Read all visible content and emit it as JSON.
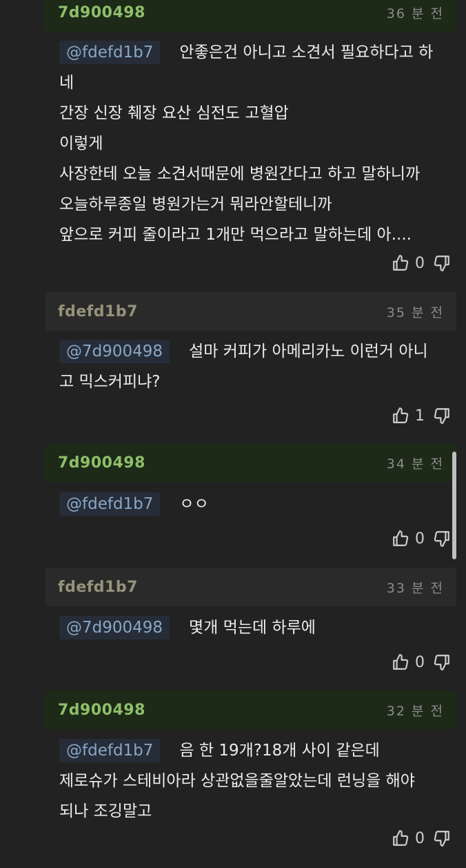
{
  "comments": [
    {
      "author": "7d900498",
      "time": "36 분 전",
      "mention": "@fdefd1b7",
      "lines": [
        "안좋은건 아니고 소견서 필요하다고 하",
        "네",
        "간장 신장 췌장 요산 심전도 고혈압",
        "이렇게",
        "사장한테 오늘 소견서때문에 병원간다고 하고 말하니까",
        "오늘하루종일 병원가는거 뭐라안할테니까",
        "앞으로 커피 줄이라고 1개만 먹으라고 말하는데 아...."
      ],
      "likes": "0"
    },
    {
      "author": "fdefd1b7",
      "time": "35 분 전",
      "mention": "@7d900498",
      "lines": [
        "설마 커피가 아메리카노 이런거 아니",
        "고 믹스커피냐?"
      ],
      "likes": "1"
    },
    {
      "author": "7d900498",
      "time": "34 분 전",
      "mention": "@fdefd1b7",
      "lines": [
        "ㅇㅇ"
      ],
      "likes": "0"
    },
    {
      "author": "fdefd1b7",
      "time": "33 분 전",
      "mention": "@7d900498",
      "lines": [
        "몇개 먹는데 하루에"
      ],
      "likes": "0"
    },
    {
      "author": "7d900498",
      "time": "32 분 전",
      "mention": "@fdefd1b7",
      "lines": [
        "음 한 19개?18개 사이 같은데",
        "제로슈가 스테비아라 상관없을줄알았는데 런닝을 해야",
        "되나 조깅말고"
      ],
      "likes": "0"
    }
  ]
}
